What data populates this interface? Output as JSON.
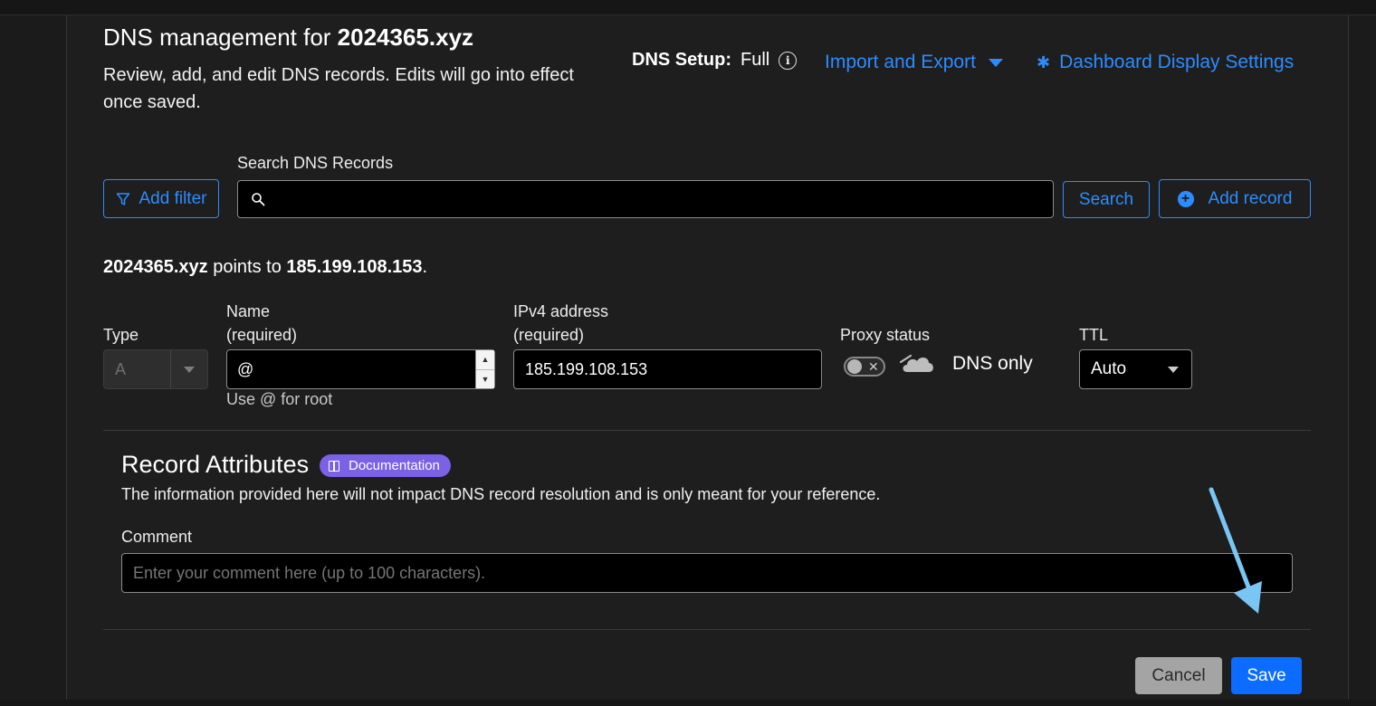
{
  "header": {
    "title_prefix": "DNS management for ",
    "domain": "2024365.xyz",
    "description": "Review, add, and edit DNS records. Edits will go into effect once saved.",
    "dns_setup_label": "DNS Setup:",
    "dns_setup_value": "Full",
    "info_icon_glyph": "i",
    "import_export_label": "Import and Export",
    "dashboard_settings_label": "Dashboard Display Settings"
  },
  "search": {
    "add_filter_label": "Add filter",
    "label": "Search DNS Records",
    "value": "",
    "search_button": "Search",
    "add_record_button": "Add record"
  },
  "points_to": {
    "domain": "2024365.xyz",
    "text": " points to ",
    "ip": "185.199.108.153",
    "end": "."
  },
  "record_form": {
    "type_label": "Type",
    "type_value": "A",
    "name_label_line1": "Name",
    "name_label_line2": "(required)",
    "name_value": "@",
    "name_help": "Use @ for root",
    "ipv4_label_line1": "IPv4 address",
    "ipv4_label_line2": "(required)",
    "ipv4_value": "185.199.108.153",
    "proxy_label": "Proxy status",
    "proxy_value": "DNS only",
    "proxy_enabled": false,
    "ttl_label": "TTL",
    "ttl_value": "Auto"
  },
  "attributes": {
    "title": "Record Attributes",
    "doc_badge": "Documentation",
    "description": "The information provided here will not impact DNS record resolution and is only meant for your reference.",
    "comment_label": "Comment",
    "comment_placeholder": "Enter your comment here (up to 100 characters).",
    "comment_value": ""
  },
  "actions": {
    "cancel": "Cancel",
    "save": "Save"
  },
  "colors": {
    "accent": "#2c8cff",
    "save": "#0b6cff",
    "badge": "#7b61e6",
    "arrow": "#79c6f5"
  },
  "icons": [
    "info-icon",
    "caret-down-icon",
    "gear-icon",
    "filter-icon",
    "search-icon",
    "plus-circle-icon",
    "select-caret-icon",
    "spinner-up-icon",
    "spinner-down-icon",
    "toggle-x-icon",
    "cloud-icon",
    "book-icon",
    "annotation-arrow"
  ]
}
